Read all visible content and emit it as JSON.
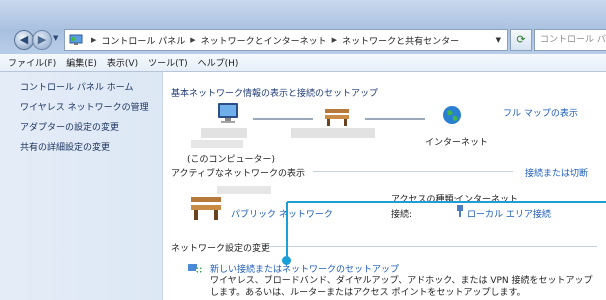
{
  "address_bar": {
    "crumbs": [
      "コントロール パネル",
      "ネットワークとインターネット",
      "ネットワークと共有センター"
    ],
    "search_placeholder": "コントロール パネ"
  },
  "menu": [
    "ファイル(F)",
    "編集(E)",
    "表示(V)",
    "ツール(T)",
    "ヘルプ(H)"
  ],
  "sidebar": {
    "items": [
      {
        "label": "コントロール パネル ホーム"
      },
      {
        "label": "ワイヤレス ネットワークの管理"
      },
      {
        "label": "アダプターの設定の変更"
      },
      {
        "label": "共有の詳細設定の変更"
      }
    ]
  },
  "main": {
    "basic_heading": "基本ネットワーク情報の表示と接続のセットアップ",
    "full_map_link": "フル マップの表示",
    "internet_label": "インターネット",
    "this_computer_label": "(このコンピューター)",
    "active_heading": "アクティブなネットワークの表示",
    "connect_disconnect_link": "接続または切断",
    "access_type_label": "アクセスの種類:",
    "access_type_value": "インターネット",
    "network_type_link": "パブリック ネットワーク",
    "connections_label": "接続:",
    "connection_link": "ローカル エリア接続",
    "change_heading": "ネットワーク設定の変更",
    "setup_link": "新しい接続またはネットワークのセットアップ",
    "setup_description": "ワイヤレス、ブロードバンド、ダイヤルアップ、アドホック、または VPN 接続をセットアップします。あるいは、ルーターまたはアクセス ポイントをセットアップします。"
  },
  "colors": {
    "link": "#1b5cbc",
    "callout": "#1aa0d6"
  }
}
